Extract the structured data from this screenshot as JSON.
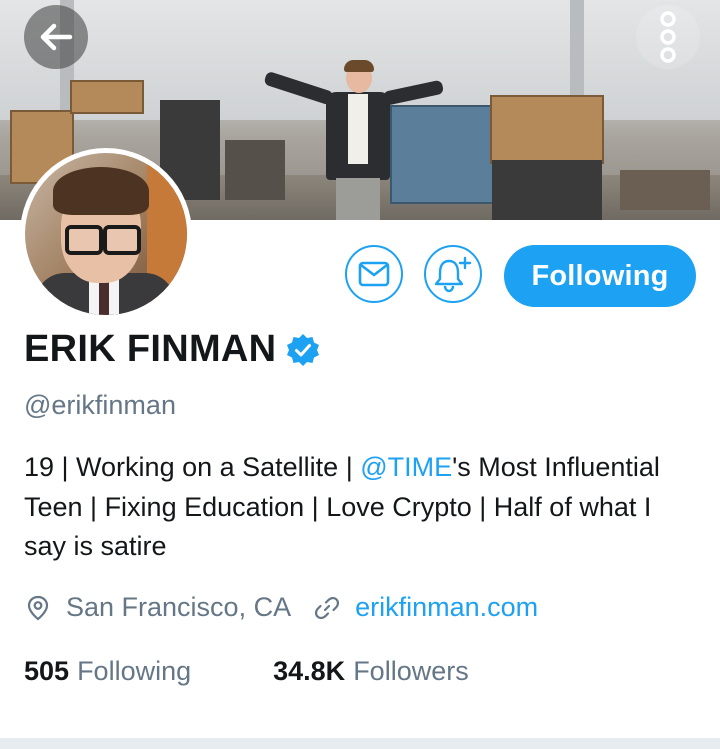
{
  "profile": {
    "name": "ERIK FINMAN",
    "handle": "@erikfinman",
    "bio": {
      "part1": "19 | Working on a Satellite | ",
      "mention": "@TIME",
      "part2": "'s Most Influential Teen | Fixing Education | Love Crypto | Half of what I say is satire"
    },
    "location": "San Francisco, CA",
    "website": "erikfinman.com",
    "following_count": "505",
    "following_label": "Following",
    "followers_count": "34.8K",
    "followers_label": "Followers"
  },
  "actions": {
    "following_button": "Following"
  },
  "icons": {
    "back": "arrow-left-icon",
    "more": "more-vertical-icon",
    "message": "envelope-icon",
    "notify": "bell-plus-icon",
    "verified": "verified-badge-icon",
    "location": "location-pin-icon",
    "link": "link-icon"
  },
  "colors": {
    "accent": "#1da1f2",
    "text": "#14171a",
    "muted": "#657786"
  }
}
